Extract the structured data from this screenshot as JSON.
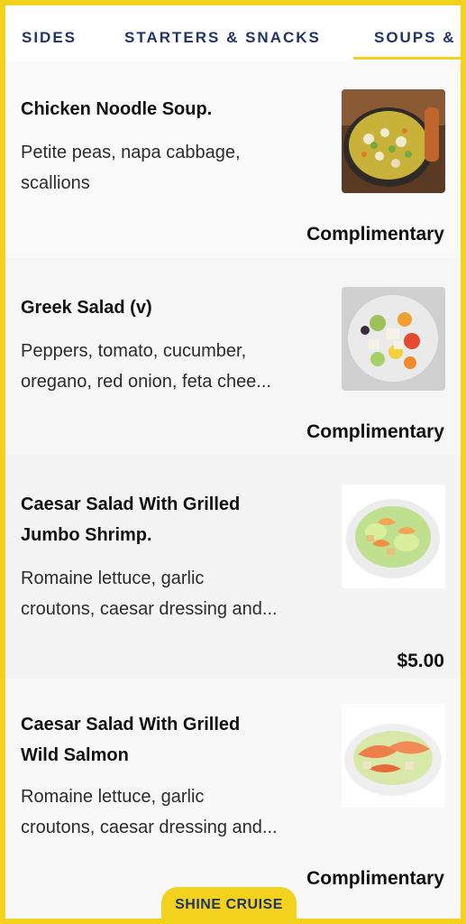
{
  "tabs": [
    {
      "label": "SIDES"
    },
    {
      "label": "STARTERS & SNACKS"
    },
    {
      "label": "SOUPS &"
    }
  ],
  "items": [
    {
      "name": "Chicken Noodle Soup.",
      "description_lines": [
        "Petite peas, napa cabbage,",
        "scallions"
      ],
      "price": "Complimentary",
      "image_icon": "soup-bowl-icon"
    },
    {
      "name": "Greek Salad (v)",
      "description_lines": [
        "Peppers, tomato, cucumber,",
        "oregano, red onion, feta chee..."
      ],
      "price": "Complimentary",
      "image_icon": "greek-salad-icon"
    },
    {
      "name_lines": [
        "Caesar Salad With Grilled",
        "Jumbo Shrimp."
      ],
      "description_lines": [
        "Romaine lettuce, garlic",
        "croutons, caesar dressing and..."
      ],
      "price": "$5.00",
      "image_icon": "caesar-shrimp-icon"
    },
    {
      "name_lines": [
        "Caesar Salad With Grilled",
        "Wild Salmon"
      ],
      "description_lines": [
        "Romaine lettuce, garlic",
        "croutons, caesar dressing and..."
      ],
      "price": "Complimentary",
      "image_icon": "caesar-salmon-icon"
    }
  ],
  "brand": "SHINE CRUISE",
  "colors": {
    "accent": "#f2d21c",
    "tab_text": "#1f3466"
  }
}
